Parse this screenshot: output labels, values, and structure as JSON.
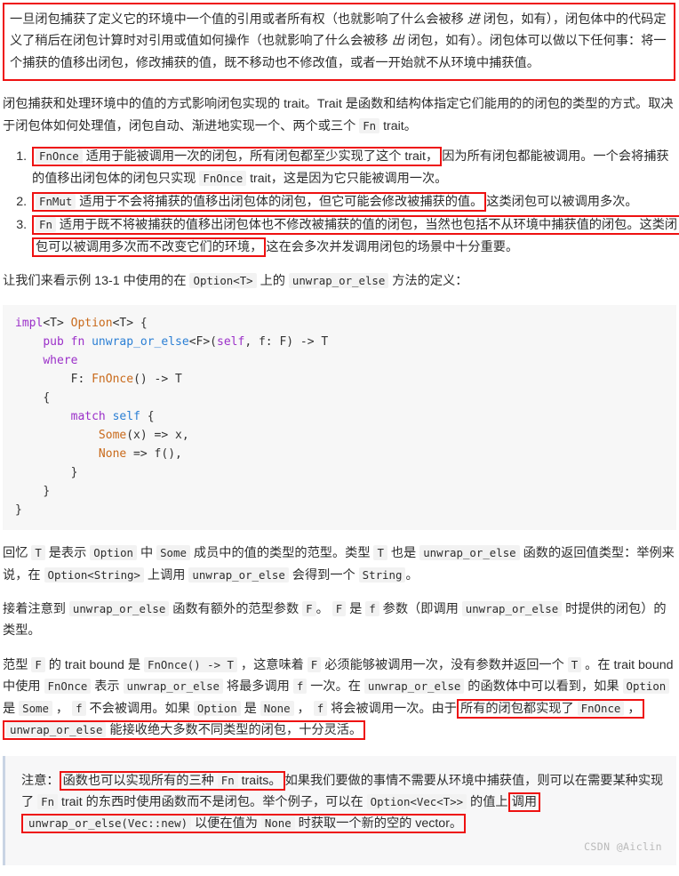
{
  "document": {
    "language": "zh-CN",
    "watermark": "CSDN @Aiclin",
    "accent_red": "#ee1111",
    "code_bg": "#f7f7f7",
    "inline_code_bg": "#f2f2f2",
    "note_bg": "#f7f7f8",
    "note_border": "#c9d4e4"
  },
  "intro_boxed": {
    "t1": "一旦闭包捕获了定义它的环境中一个值的引用或者所有权（也就影响了什么会被移 ",
    "em1": "进",
    "t2": " 闭包，如有），闭包体中的代码定义了稍后在闭包计算时对引用或值如何操作（也就影响了什么会被移 ",
    "em2": "出",
    "t3": " 闭包，如有）。闭包体可以做以下任何事：将一个捕获的值移出闭包，修改捕获的值，既不移动也不修改值，或者一开始就不从环境中捕获值。"
  },
  "para_trait_intro": {
    "t1": "闭包捕获和处理环境中的值的方式影响闭包实现的 trait。Trait 是函数和结构体指定它们能用的的闭包的类型的方式。取决于闭包体如何处理值，闭包自动、渐进地实现一个、两个或三个 ",
    "code1": "Fn",
    "t2": " trait。"
  },
  "trait_list": [
    {
      "code": "FnOnce",
      "highlighted": "适用于能被调用一次的闭包，所有闭包都至少实现了这个 trait，",
      "rest_a": "因为所有闭包都能被调用。一个会将捕获的值移出闭包体的闭包只实现 ",
      "code2": "FnOnce",
      "rest_b": " trait，这是因为它只能被调用一次。"
    },
    {
      "code": "FnMut",
      "highlighted": "适用于不会将捕获的值移出闭包体的闭包，但它可能会修改被捕获的值。",
      "rest_a": "这类闭包可以被调用多次。",
      "code2": "",
      "rest_b": ""
    },
    {
      "code": "Fn",
      "highlighted": "适用于既不将被捕获的值移出闭包体也不修改被捕获的值的闭包，当然也包括不从环境中捕获值的闭包。这类闭包可以被调用多次而不改变它们的环境，",
      "rest_a": "这在会多次并发调用闭包的场景中十分重要。",
      "code2": "",
      "rest_b": ""
    }
  ],
  "para_example": {
    "t1": "让我们来看示例 13-1 中使用的在 ",
    "code1": "Option<T>",
    "t2": " 上的 ",
    "code2": "unwrap_or_else",
    "t3": " 方法的定义："
  },
  "code_block": {
    "language": "rust",
    "lines": [
      "impl<T> Option<T> {",
      "    pub fn unwrap_or_else<F>(self, f: F) -> T",
      "    where",
      "        F: FnOnce() -> T",
      "    {",
      "        match self {",
      "            Some(x) => x,",
      "            None => f(),",
      "        }",
      "    }",
      "}"
    ]
  },
  "para_recall": {
    "t1": "回忆 ",
    "c1": "T",
    "t2": " 是表示 ",
    "c2": "Option",
    "t3": " 中 ",
    "c3": "Some",
    "t4": " 成员中的值的类型的范型。类型 ",
    "c4": "T",
    "t5": " 也是 ",
    "c5": "unwrap_or_else",
    "t6": " 函数的返回值类型：举例来说，在 ",
    "c6": "Option<String>",
    "t7": " 上调用 ",
    "c7": "unwrap_or_else",
    "t8": " 会得到一个 ",
    "c8": "String",
    "t9": "。"
  },
  "para_generic": {
    "t1": "接着注意到 ",
    "c1": "unwrap_or_else",
    "t2": " 函数有额外的范型参数 ",
    "c2": "F",
    "t3": "。 ",
    "c3": "F",
    "t4": " 是 ",
    "c4": "f",
    "t5": " 参数（即调用 ",
    "c5": "unwrap_or_else",
    "t6": " 时提供的闭包）的类型。"
  },
  "para_bound": {
    "t1": "范型 ",
    "c1": "F",
    "t2": " 的 trait bound 是 ",
    "c2": "FnOnce() -> T",
    "t3": " ，这意味着 ",
    "c3": "F",
    "t4": " 必须能够被调用一次，没有参数并返回一个 ",
    "c4": "T",
    "t5": " 。在 trait bound 中使用 ",
    "c5": "FnOnce",
    "t6": " 表示 ",
    "c6": "unwrap_or_else",
    "t7": " 将最多调用 ",
    "c7": "f",
    "t8": " 一次。在 ",
    "c8": "unwrap_or_else",
    "t9": " 的函数体中可以看到，如果 ",
    "c9": "Option",
    "t10": " 是 ",
    "c10": "Some",
    "t11": " ， ",
    "c11": "f",
    "t12": " 不会被调用。如果 ",
    "c12": "Option",
    "t13": " 是 ",
    "c13": "None",
    "t14": " ， ",
    "c14": "f",
    "t15": " 将会被调用一次。由于",
    "hl_a": "所有的闭包都实现了 ",
    "hl_c1": "FnOnce",
    "hl_b": " ， ",
    "hl_c2": "unwrap_or_else",
    "hl_c": " 能接收绝大多数不同类型的闭包，十分灵活。"
  },
  "note": {
    "label": "注意：",
    "hl1_a": "函数也可以实现所有的三种 ",
    "hl1_c": "Fn",
    "hl1_b": " traits。",
    "mid_a": "如果我们要做的事情不需要从环境中捕获值，则可以在需要某种实现了 ",
    "mid_c1": "Fn",
    "mid_b": " trait 的东西时使用函数而不是闭包。举个例子，可以在 ",
    "mid_c2": "Option<Vec<T>>",
    "mid_c": " 的值上",
    "hl2_a": "调用 ",
    "hl2_c": "unwrap_or_else(Vec::new)",
    "hl2_b": " 以便在值为 ",
    "hl2_c2": "None",
    "hl2_d": " 时获取一个新的空的 vector。"
  }
}
